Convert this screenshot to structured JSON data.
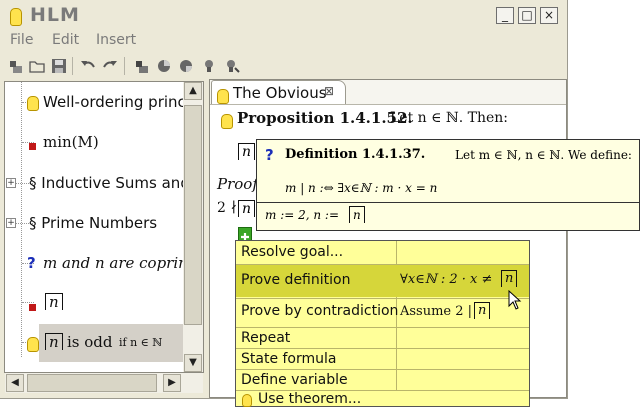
{
  "window": {
    "title": "HLM",
    "minimize_glyph": "_",
    "maximize_glyph": "□",
    "close_glyph": "×"
  },
  "menubar": [
    "File",
    "Edit",
    "Insert"
  ],
  "toolbar": {
    "icons": [
      "new-theorem-icon",
      "open-folder-icon",
      "save-icon",
      "undo-icon",
      "redo-icon",
      "add-item-icon",
      "pie-icon",
      "pie-alt-icon",
      "bulb-check-icon",
      "bulb-tools-icon"
    ]
  },
  "tree": {
    "items": [
      {
        "icon": "bulb-icon",
        "label": "Well-ordering princip"
      },
      {
        "icon": "red-square-icon",
        "label": "min(M)"
      },
      {
        "icon": "section-icon",
        "label": "§ Inductive Sums and"
      },
      {
        "icon": "section-icon",
        "label": "§ Prime Numbers"
      },
      {
        "icon": "question-icon",
        "label": "m and n are coprime"
      },
      {
        "icon": "red-square-icon",
        "label": "n"
      },
      {
        "icon": "bulb-icon",
        "label": "n is odd",
        "sublabel": "if n ∈ ℕ"
      }
    ]
  },
  "editor": {
    "tab_title": "The Obvious",
    "tab_close_glyph": "⊠",
    "proposition": {
      "heading": "Proposition 1.4.1.52.",
      "text": "Let n ∈ ℕ. Then:",
      "boxed": "n",
      "proof_label": "Proof.",
      "line": "2 ∤",
      "line_boxed": "n"
    }
  },
  "tooltip": {
    "icon": "?",
    "heading": "Definition 1.4.1.37.",
    "text": "Let m ∈ ℕ, n ∈ ℕ. We define:",
    "formula": "m | n  :⇔  ∃x∈ℕ : m · x = n",
    "assignment_prefix": "m := 2, n :=",
    "assignment_boxed": "n"
  },
  "context_menu": {
    "items": [
      {
        "label": "Resolve goal...",
        "detail": ""
      },
      {
        "label": "Prove definition",
        "detail": "∀x∈ℕ : 2 · x ≠",
        "detail_boxed": "n",
        "highlighted": true
      },
      {
        "label": "Prove by contradiction",
        "detail": "Assume 2 |",
        "detail_boxed": "n"
      },
      {
        "label": "Repeat",
        "detail": ""
      },
      {
        "label": "State formula",
        "detail": ""
      },
      {
        "label": "Define variable",
        "detail": ""
      },
      {
        "label": "Use theorem...",
        "detail": "",
        "icon": "bulb-icon"
      }
    ]
  },
  "colors": {
    "menu_bg": "#ffff99",
    "menu_highlight": "#d6d63a",
    "tooltip_bg": "#ffffe1",
    "question_blue": "#1c2fb8",
    "red_square": "#c01818"
  }
}
